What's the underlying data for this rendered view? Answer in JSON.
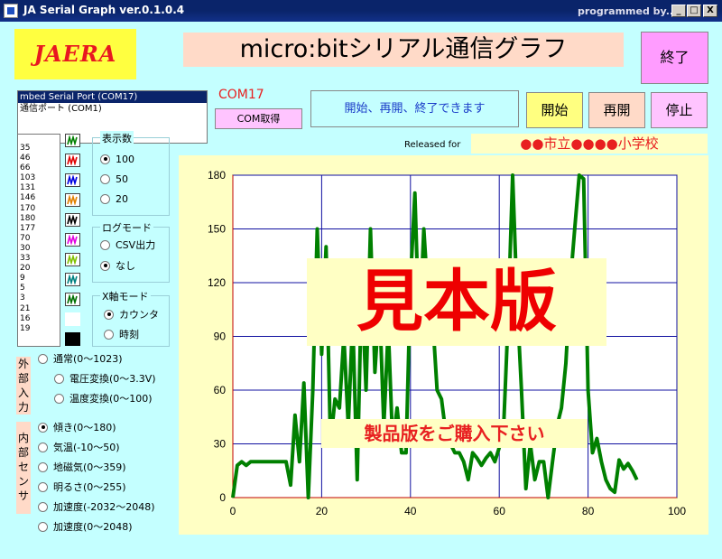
{
  "window": {
    "title": "JA Serial Graph  ver.0.1.0.4",
    "credit": "programmed by...",
    "controls": {
      "minimize": "_",
      "maximize": "□",
      "close": "X"
    }
  },
  "logo_text": "JAERA",
  "app_title": "micro:bitシリアル通信グラフ",
  "quit_label": "終了",
  "ports": {
    "items": [
      "mbed Serial Port (COM17)",
      "通信ポート (COM1)"
    ],
    "selected_index": 0
  },
  "com_label": "COM17",
  "com_get_label": "COM取得",
  "status_text": "開始、再開、終了できます",
  "buttons": {
    "start": "開始",
    "resume": "再開",
    "stop": "停止"
  },
  "released_label": "Released for",
  "school": "●●市立●●●●小学校",
  "values_list": [
    "35",
    "46",
    "66",
    "103",
    "131",
    "146",
    "170",
    "180",
    "177",
    "70",
    "30",
    "33",
    "20",
    "9",
    "5",
    "3",
    "21",
    "16",
    "19"
  ],
  "series_colors": [
    "#008000",
    "#e00000",
    "#0000e0",
    "#e08000",
    "#000000",
    "#e000e0",
    "#80c000",
    "#008080",
    "#007000",
    "#ffffff",
    "#000000"
  ],
  "display_count": {
    "title": "表示数",
    "options": [
      "100",
      "50",
      "20"
    ],
    "selected": "100"
  },
  "log_mode": {
    "title": "ログモード",
    "options": [
      "CSV出力",
      "なし"
    ],
    "selected": "なし"
  },
  "x_axis_mode": {
    "title": "X軸モード",
    "options": [
      "カウンタ",
      "時刻"
    ],
    "selected": "カウンタ"
  },
  "external_input": {
    "label": "外部入力",
    "options": [
      "通常(0〜1023)",
      "電圧変換(0〜3.3V)",
      "温度変換(0〜100)"
    ],
    "selected": null
  },
  "internal_sensor": {
    "label": "内部センサ",
    "options": [
      "傾き(0〜180)",
      "気温(-10〜50)",
      "地磁気(0〜359)",
      "明るさ(0〜255)",
      "加速度(-2032〜2048)",
      "加速度(0〜2048)"
    ],
    "selected": "傾き(0〜180)"
  },
  "watermark": "見本版",
  "buy_banner": "製品版をご購入下さい",
  "chart_data": {
    "type": "line",
    "xlim": [
      0,
      100
    ],
    "ylim": [
      0,
      180
    ],
    "xticks": [
      "0",
      "20",
      "40",
      "60",
      "80",
      "100"
    ],
    "yticks": [
      "0",
      "30",
      "60",
      "90",
      "120",
      "150",
      "180"
    ],
    "grid": true,
    "series": [
      {
        "color": "#008000",
        "x": [
          0,
          1,
          2,
          3,
          4,
          5,
          6,
          7,
          8,
          9,
          10,
          11,
          12,
          13,
          14,
          15,
          16,
          17,
          18,
          19,
          20,
          21,
          22,
          23,
          24,
          25,
          26,
          27,
          28,
          29,
          30,
          31,
          32,
          33,
          34,
          35,
          36,
          37,
          38,
          39,
          40,
          41,
          42,
          43,
          44,
          45,
          46,
          47,
          48,
          49,
          50,
          51,
          52,
          53,
          54,
          55,
          56,
          57,
          58,
          59,
          60,
          61,
          62,
          63,
          64,
          65,
          66,
          67,
          68,
          69,
          70,
          71,
          72,
          73,
          74,
          75,
          76,
          77,
          78,
          79,
          80,
          81,
          82,
          83,
          84,
          85,
          86,
          87,
          88,
          89,
          90,
          91
        ],
        "y": [
          0,
          18,
          20,
          18,
          20,
          20,
          20,
          20,
          20,
          20,
          20,
          20,
          20,
          7,
          46,
          20,
          64,
          0,
          60,
          150,
          80,
          140,
          30,
          55,
          50,
          90,
          40,
          100,
          10,
          120,
          60,
          150,
          70,
          110,
          40,
          95,
          30,
          50,
          25,
          25,
          120,
          170,
          90,
          150,
          110,
          100,
          60,
          55,
          35,
          30,
          25,
          25,
          20,
          10,
          25,
          22,
          18,
          22,
          25,
          20,
          28,
          40,
          100,
          180,
          110,
          60,
          5,
          30,
          10,
          20,
          20,
          0,
          20,
          40,
          50,
          75,
          120,
          150,
          180,
          178,
          60,
          25,
          33,
          20,
          10,
          5,
          3,
          21,
          16,
          19,
          15,
          10
        ]
      }
    ]
  }
}
